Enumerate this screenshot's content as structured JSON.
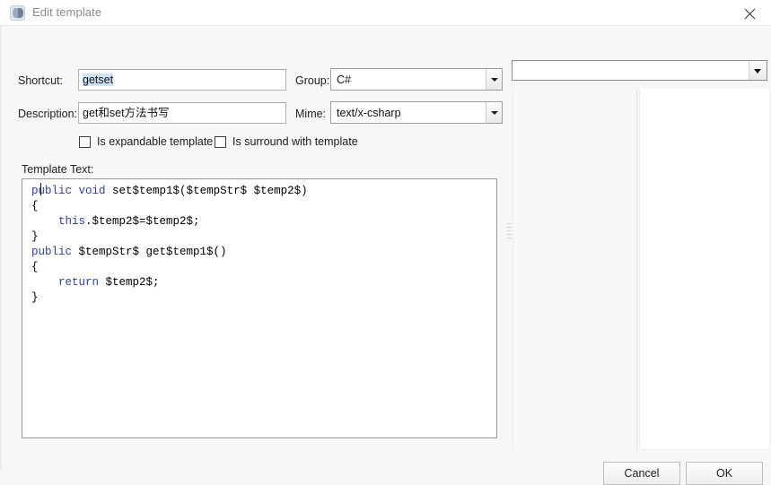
{
  "window": {
    "title": "Edit template",
    "icon": "template-app-icon",
    "close_icon": "close-icon"
  },
  "form": {
    "shortcut": {
      "label": "Shortcut:",
      "value": "getset",
      "selected": true
    },
    "description": {
      "label": "Description:",
      "value": "get和set方法书写"
    },
    "group": {
      "label": "Group:",
      "value": "C#",
      "arrow_icon": "chevron-down-icon"
    },
    "mime": {
      "label": "Mime:",
      "value": "text/x-csharp",
      "arrow_icon": "chevron-down-icon"
    },
    "checkboxes": [
      {
        "label": "Is expandable template",
        "checked": false
      },
      {
        "label": "Is surround with template",
        "checked": false
      }
    ]
  },
  "template_text": {
    "label": "Template Text:",
    "lines": [
      {
        "indent": 0,
        "tokens": [
          {
            "t": "public",
            "k": true
          },
          {
            "t": " "
          },
          {
            "t": "void",
            "k": true
          },
          {
            "t": " set$temp1$($tempStr$ $temp2$)"
          }
        ]
      },
      {
        "indent": 0,
        "tokens": [
          {
            "t": "{"
          }
        ]
      },
      {
        "indent": 1,
        "tokens": [
          {
            "t": "this",
            "k": true
          },
          {
            "t": ".$temp2$=$temp2$;"
          }
        ]
      },
      {
        "indent": 0,
        "tokens": [
          {
            "t": "}"
          }
        ]
      },
      {
        "indent": 0,
        "tokens": [
          {
            "t": "public",
            "k": true
          },
          {
            "t": " $tempStr$ get$temp1$()"
          }
        ]
      },
      {
        "indent": 0,
        "tokens": [
          {
            "t": "{"
          }
        ]
      },
      {
        "indent": 1,
        "tokens": [
          {
            "t": "return",
            "k": true
          },
          {
            "t": " $temp2$;"
          }
        ]
      },
      {
        "indent": 0,
        "tokens": [
          {
            "t": "}"
          }
        ]
      }
    ],
    "plain": "public void set$temp1$($tempStr$ $temp2$)\n{\n    this.$temp2$=$temp2$;\n}\npublic $tempStr$ get$temp1$()\n{\n    return $temp2$;\n}"
  },
  "right_panel": {
    "top_combo": {
      "value": "",
      "arrow_icon": "chevron-down-icon"
    },
    "gray_pane": "",
    "white_pane": ""
  },
  "footer": {
    "cancel_label": "Cancel",
    "ok_label": "OK"
  },
  "colors": {
    "keyword": "#2e3ea8",
    "selection": "#cfe3f7",
    "title_text": "#8a8a8a",
    "window_bg": "#f7f7f7"
  }
}
